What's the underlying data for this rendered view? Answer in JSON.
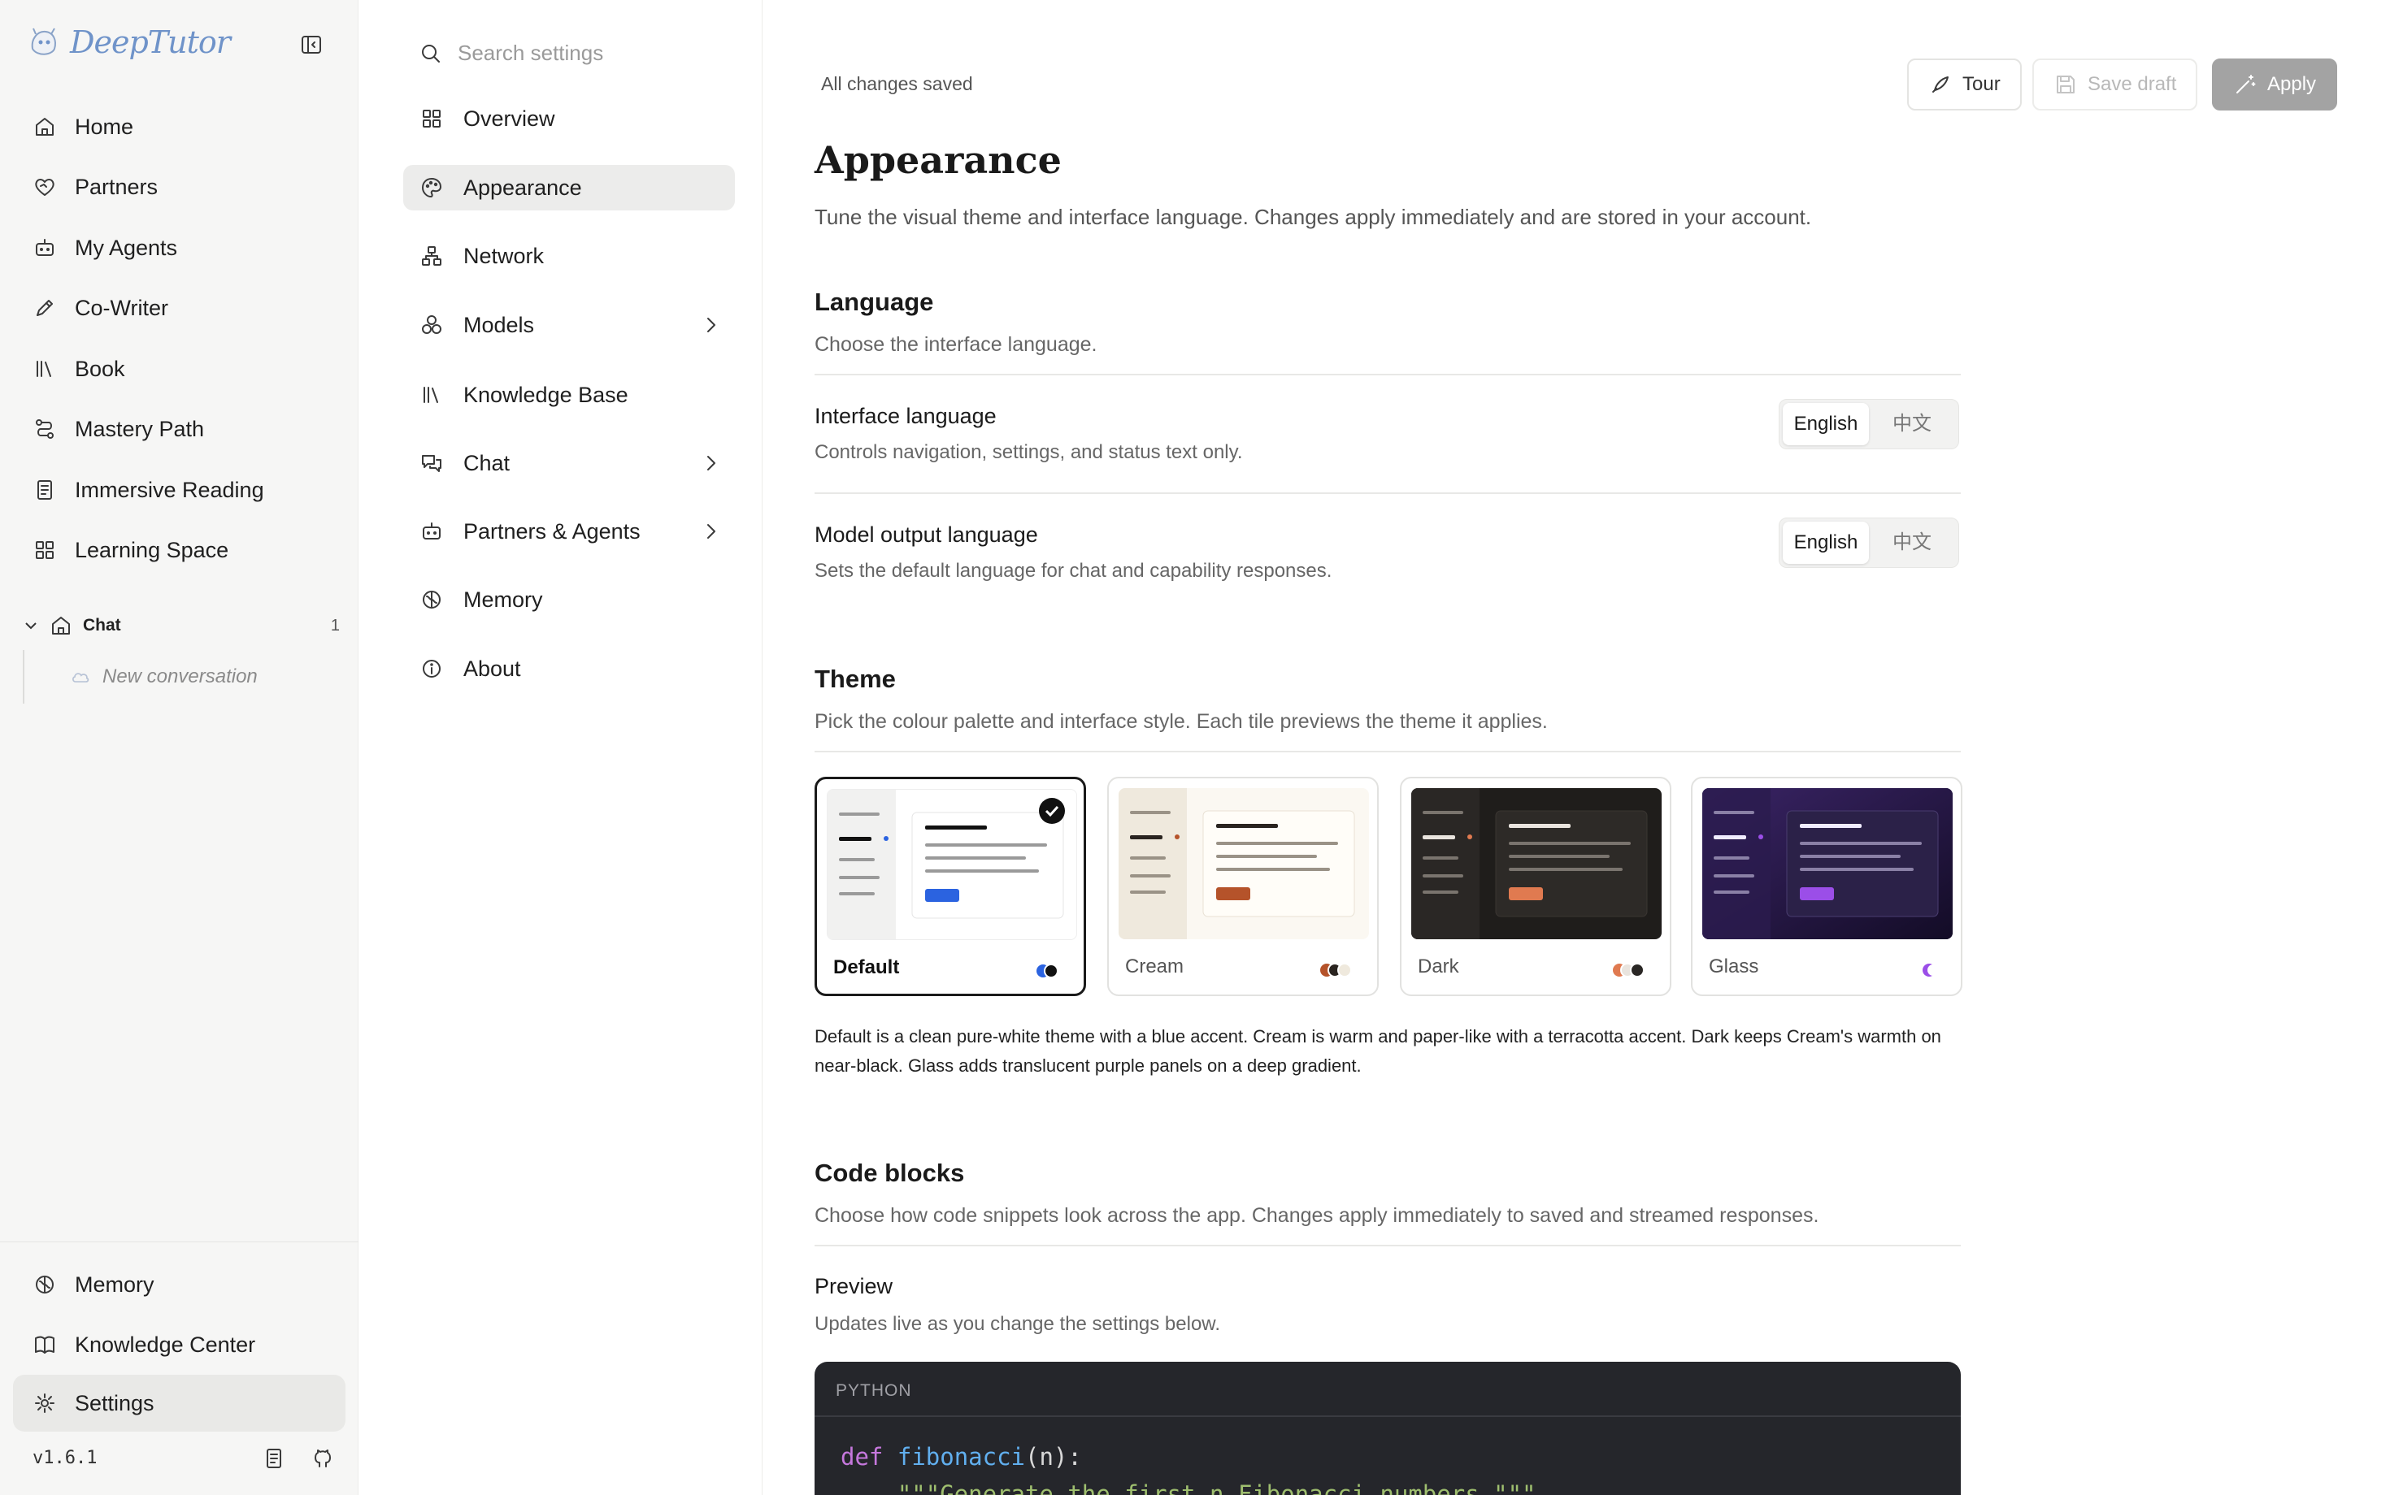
{
  "brand": {
    "name": "DeepTutor"
  },
  "sidebar": {
    "items": [
      {
        "label": "Home",
        "icon": "home-icon"
      },
      {
        "label": "Partners",
        "icon": "heart-handshake-icon"
      },
      {
        "label": "My Agents",
        "icon": "bot-icon"
      },
      {
        "label": "Co-Writer",
        "icon": "pen-icon"
      },
      {
        "label": "Book",
        "icon": "library-icon"
      },
      {
        "label": "Mastery Path",
        "icon": "route-icon"
      },
      {
        "label": "Immersive Reading",
        "icon": "reader-icon"
      },
      {
        "label": "Learning Space",
        "icon": "grid-icon"
      }
    ],
    "chat_group": {
      "label": "Chat",
      "count": "1",
      "conversation": "New conversation"
    },
    "bottom_items": [
      {
        "label": "Memory",
        "icon": "brain-icon"
      },
      {
        "label": "Knowledge Center",
        "icon": "book-open-icon"
      },
      {
        "label": "Settings",
        "icon": "gear-icon"
      }
    ],
    "version": "v1.6.1"
  },
  "settings_nav": {
    "search_placeholder": "Search settings",
    "items": [
      {
        "label": "Overview"
      },
      {
        "label": "Appearance"
      },
      {
        "label": "Network"
      },
      {
        "label": "Models"
      },
      {
        "label": "Knowledge Base"
      },
      {
        "label": "Chat"
      },
      {
        "label": "Partners & Agents"
      },
      {
        "label": "Memory"
      },
      {
        "label": "About"
      }
    ]
  },
  "toolbar": {
    "status": "All changes saved",
    "tour_label": "Tour",
    "save_draft_label": "Save draft",
    "apply_label": "Apply"
  },
  "page": {
    "title": "Appearance",
    "subtitle": "Tune the visual theme and interface language. Changes apply immediately and are stored in your account."
  },
  "language": {
    "title": "Language",
    "desc": "Choose the interface language.",
    "interface": {
      "label": "Interface language",
      "help": "Controls navigation, settings, and status text only.",
      "options": [
        "English",
        "中文"
      ],
      "selected": "English"
    },
    "model_output": {
      "label": "Model output language",
      "help": "Sets the default language for chat and capability responses.",
      "options": [
        "English",
        "中文"
      ],
      "selected": "English"
    }
  },
  "theme": {
    "title": "Theme",
    "desc": "Pick the colour palette and interface style. Each tile previews the theme it applies.",
    "tiles": [
      {
        "name": "Default",
        "selected": true,
        "accent": "#2b63e0"
      },
      {
        "name": "Cream",
        "selected": false,
        "accent": "#b5532a"
      },
      {
        "name": "Dark",
        "selected": false,
        "accent": "#e07a50"
      },
      {
        "name": "Glass",
        "selected": false,
        "accent": "#9b4ee8"
      }
    ],
    "note": "Default is a clean pure-white theme with a blue accent. Cream is warm and paper-like with a terracotta accent. Dark keeps Cream's warmth on near-black. Glass adds translucent purple panels on a deep gradient."
  },
  "code_blocks": {
    "title": "Code blocks",
    "desc": "Choose how code snippets look across the app. Changes apply immediately to saved and streamed responses.",
    "preview_title": "Preview",
    "preview_desc": "Updates live as you change the settings below.",
    "language": "PYTHON",
    "line1_kw": "def",
    "line1_fn": "fibonacci",
    "line1_rest": "(n):",
    "line2": "    \"\"\"Generate the first n Fibonacci numbers.\"\"\""
  }
}
